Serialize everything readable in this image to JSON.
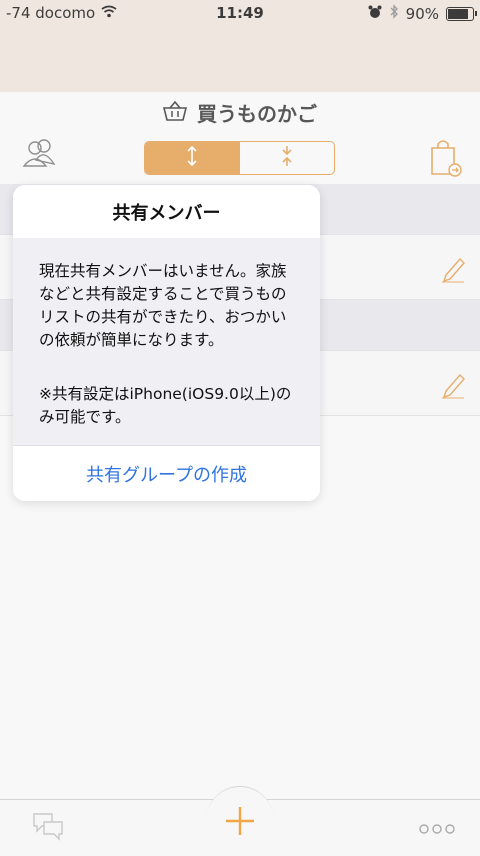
{
  "status_bar": {
    "carrier": "-74 docomo",
    "time": "11:49",
    "battery_percent": "90%",
    "battery_level": 0.9,
    "icons": [
      "wifi-icon",
      "alarm-icon",
      "bluetooth-icon",
      "battery-icon"
    ]
  },
  "navbar": {
    "title": "買うものかご",
    "icons": [
      "basket-icon",
      "people-icon",
      "expand-icon",
      "collapse-icon",
      "bag-export-icon"
    ],
    "segmented_selected_index": 0
  },
  "list": {
    "row_icons": [
      "pencil-icon"
    ]
  },
  "popover": {
    "title": "共有メンバー",
    "message": "現在共有メンバーはいません。家族などと共有設定することで買うものリストの共有ができたり、おつかいの依頼が簡単になります。",
    "note": "※共有設定はiPhone(iOS9.0以上)のみ可能です。",
    "action": "共有グループの作成"
  },
  "tabbar": {
    "icons": [
      "chat-icon",
      "plus-icon",
      "more-icon"
    ]
  },
  "colors": {
    "accent": "#e19c4b",
    "link_blue": "#2f74e0",
    "topband": "#ece2d8"
  }
}
